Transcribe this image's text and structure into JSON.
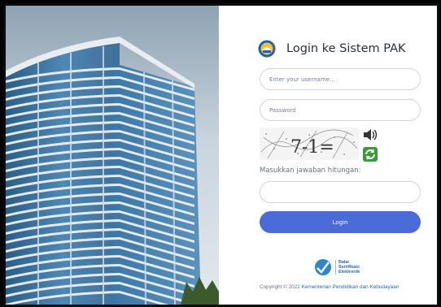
{
  "login": {
    "title": "Login ke Sistem PAK",
    "username_placeholder": "Enter your username...",
    "password_placeholder": "Password",
    "answer_label": "Masukkan jawaban hitungan:",
    "login_label": "Login"
  },
  "captcha": {
    "text": "7-1=",
    "audio_icon": "speaker-icon",
    "refresh_icon": "refresh-icon"
  },
  "branding": {
    "line1": "Balai",
    "line2": "Sertifikasi",
    "line3": "Elektronik"
  },
  "footer": {
    "copyright": "Copyright © 2022 ",
    "link": "Kementerian Pendidikan dan Kebudayaan"
  },
  "colors": {
    "accent": "#4b6bd8",
    "link": "#2a67b5"
  }
}
